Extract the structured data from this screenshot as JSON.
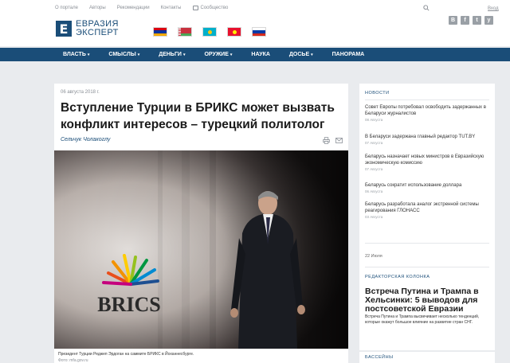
{
  "header": {
    "top_links": [
      "О портале",
      "Авторы",
      "Рекомендации",
      "Контакты",
      "Сообщество"
    ],
    "login": "Вход",
    "logo_letter": "Е",
    "logo_line1": "ЕВРАЗИЯ",
    "logo_line2": "ЭКСПЕРТ",
    "socials": [
      "В",
      "f",
      "t",
      "y"
    ],
    "flags": [
      "armenia-flag",
      "belarus-flag",
      "kazakhstan-flag",
      "kyrgyzstan-flag",
      "russia-flag"
    ]
  },
  "nav": {
    "items": [
      {
        "label": "ВЛАСТЬ",
        "dropdown": true
      },
      {
        "label": "СМЫСЛЫ",
        "dropdown": true
      },
      {
        "label": "ДЕНЬГИ",
        "dropdown": true
      },
      {
        "label": "ОРУЖИЕ",
        "dropdown": true
      },
      {
        "label": "НАУКА",
        "dropdown": false
      },
      {
        "label": "ДОСЬЕ",
        "dropdown": true
      },
      {
        "label": "ПАНОРАМА",
        "dropdown": false
      }
    ],
    "caret": "▾"
  },
  "article": {
    "date": "06 августа 2018 г.",
    "headline": "Вступление Турции в БРИКС может вызвать конфликт интересов – турецкий политолог",
    "author": "Сельчук Чолакоглу",
    "photo_sign": "BRICS",
    "caption": "Президент Турции Реджеп Эрдоган на саммите БРИКС в Йоханнесбурге.",
    "credit": "Фото: mfa.gov.ru"
  },
  "sidebar": {
    "news_title": "НОВОСТИ",
    "news": [
      {
        "text": "Совет Европы потребовал освободить задержанных в Беларуси журналистов",
        "date": "08 Августа"
      },
      {
        "text": "В Беларуси задержана главный редактор TUT.BY",
        "date": "07 Августа"
      },
      {
        "text": "Беларусь назначает новых министров в Евразийскую экономическую комиссию",
        "date": "07 Августа"
      },
      {
        "text": "Беларусь сократит использование доллара",
        "date": "06 Августа"
      },
      {
        "text": "Беларусь разработала аналог экстренной системы реагирования ГЛОНАСС",
        "date": "03 Августа"
      }
    ],
    "column_date": "22 Июля",
    "column_title": "РЕДАКТОРСКАЯ КОЛОНКА",
    "column_headline": "Встреча Путина и Трампа в Хельсинки: 5 выводов для постсоветской Евразии",
    "column_lead": "Встреча Путина и Трампа высвечивает несколько тенденций, которые окажут большое влияние на развитие стран СНГ.",
    "bottom_title": "БАССЕЙНЫ"
  }
}
